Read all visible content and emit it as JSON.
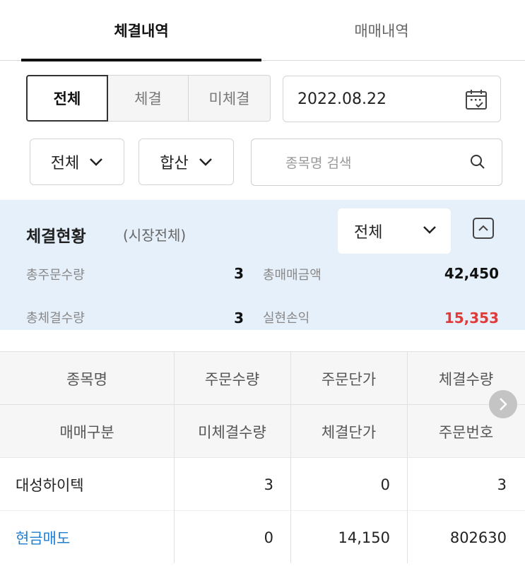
{
  "tabs": [
    {
      "label": "체결내역",
      "active": true
    },
    {
      "label": "매매내역",
      "active": false
    }
  ],
  "filter": {
    "segments": [
      {
        "label": "전체",
        "active": true
      },
      {
        "label": "체결",
        "active": false
      },
      {
        "label": "미체결",
        "active": false
      }
    ],
    "date": "2022.08.22",
    "dropdown_market": "전체",
    "dropdown_mode": "합산",
    "search_placeholder": "종목명 검색"
  },
  "summary": {
    "title": "체결현황",
    "subtitle": "(시장전체)",
    "select_value": "전체",
    "total_order_qty_label": "총주문수량",
    "total_order_qty": "3",
    "total_trade_amount_label": "총매매금액",
    "total_trade_amount": "42,450",
    "total_exec_qty_label": "총체결수량",
    "total_exec_qty": "3",
    "realized_pnl_label": "실현손익",
    "realized_pnl": "15,353"
  },
  "table": {
    "headers_row1": [
      "종목명",
      "주문수량",
      "주문단가",
      "체결수량"
    ],
    "headers_row2": [
      "매매구분",
      "미체결수량",
      "체결단가",
      "주문번호"
    ],
    "rows": [
      {
        "line1": [
          "대성하이텍",
          "3",
          "0",
          "3"
        ],
        "line2": [
          "현금매도",
          "0",
          "14,150",
          "802630"
        ]
      }
    ]
  },
  "colors": {
    "accent_blue": "#1f7fd0",
    "profit_red": "#e03a3a",
    "summary_bg": "#e6f0fb"
  }
}
